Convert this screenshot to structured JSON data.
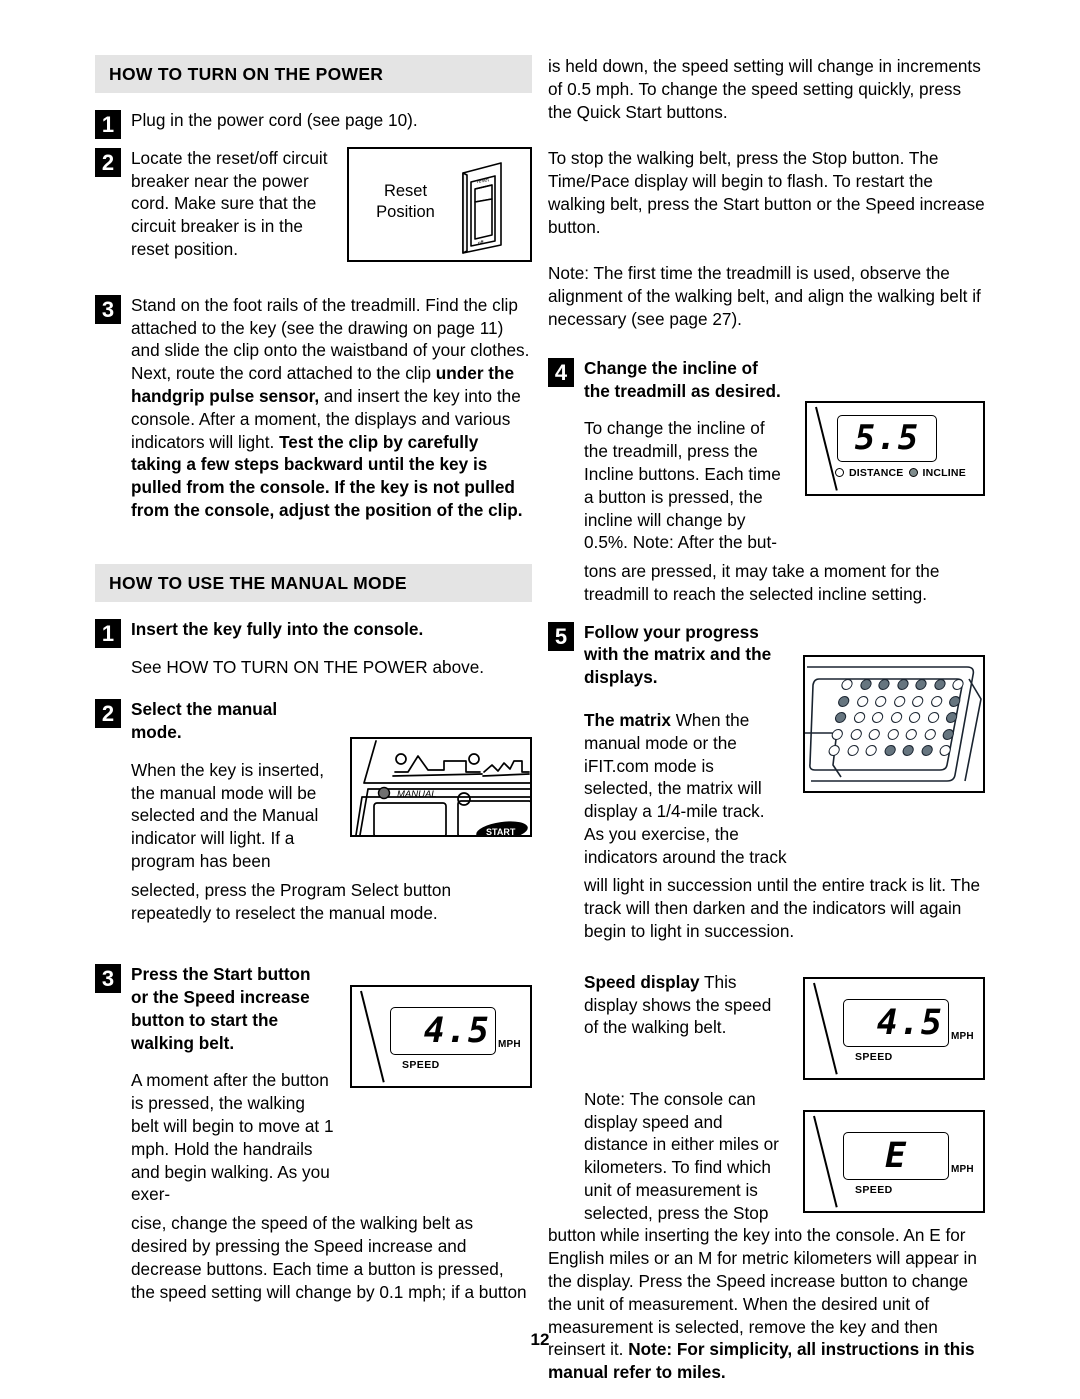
{
  "page": {
    "number": "12"
  },
  "left_column": {
    "section1": {
      "heading": "HOW TO TURN ON THE POWER",
      "steps": [
        {
          "num": "1",
          "text": "Plug in the power cord (see page 10)."
        },
        {
          "num": "2",
          "text": "Locate the reset/off circuit breaker near the power cord. Make sure that the circuit breaker is in the reset position."
        },
        {
          "num": "3",
          "text_plain_1": "Stand on the foot rails of the treadmill. Find the clip attached to the key (see the drawing on page 11) and slide the clip onto the waistband of your clothes. Next, route the cord attached to the clip ",
          "text_bold_1": "under the handgrip pulse sensor,",
          "text_plain_2": " and insert the key into the console. After a moment, the displays and various indicators will light. ",
          "text_bold_2": "Test the clip by carefully taking a few steps backward until the key is pulled from the console. If the key is not pulled from the console, adjust the position of the clip."
        }
      ],
      "figure_reset": {
        "label_line1": "Reset",
        "label_line2": "Position",
        "switch_top_text": "reset",
        "switch_bottom_text": "off"
      }
    },
    "section2": {
      "heading": "HOW TO USE THE MANUAL MODE",
      "steps": [
        {
          "num": "1",
          "title": "Insert the key fully into the console.",
          "body": "See HOW TO TURN ON THE POWER above."
        },
        {
          "num": "2",
          "title": "Select the manual mode.",
          "body_wrap": "When the key is inserted, the manual mode will be selected and the Manual indicator will light. If a program has been",
          "body_rest": "selected, press the Program Select button repeatedly to reselect the manual mode."
        },
        {
          "num": "3",
          "title": "Press the Start button or the Speed increase button to start the walking belt.",
          "body_wrap": "A moment after the button is pressed, the walking belt will begin to move at 1 mph. Hold the handrails and begin walking. As you exer-",
          "body_rest": "cise, change the speed of the walking belt as desired by pressing the Speed increase and decrease buttons. Each time a button is pressed, the speed setting will change by 0.1 mph; if a button"
        }
      ],
      "figure_console": {
        "indicator_label": "MANUAL"
      },
      "figure_speed": {
        "value": "4.5",
        "unit": "MPH",
        "caption": "SPEED"
      }
    }
  },
  "right_column": {
    "continued_paragraphs": [
      "is held down, the speed setting will change in increments of 0.5 mph. To change the speed setting quickly, press the Quick Start buttons.",
      "To stop the walking belt, press the Stop button. The Time/Pace display will begin to flash. To restart the walking belt, press the Start button or the Speed increase button.",
      "Note: The first time the treadmill is used, observe the alignment of the walking belt, and align the walking belt if necessary (see page 27)."
    ],
    "steps": [
      {
        "num": "4",
        "title": "Change the incline of the treadmill as desired.",
        "body_wrap": "To change the incline of the treadmill, press the Incline buttons. Each time a button is pressed, the incline will change by 0.5%. Note: After the but-",
        "body_rest": "tons are pressed, it may take a moment for the treadmill to reach the selected incline setting."
      },
      {
        "num": "5",
        "title": "Follow your progress with the matrix and the displays.",
        "matrix_lead_bold": "The matrix",
        "matrix_body_wrap": " When the manual mode or the iFIT.com mode is selected, the matrix will display a 1/4-mile track. As you exercise, the indicators around the track",
        "matrix_body_rest": "will light in succession until the entire track is lit. The track will then darken and the indicators will again begin to light in succession.",
        "speed_lead_bold": "Speed display",
        "speed_body": " This display shows the speed of the walking belt.",
        "note_wrap": "Note: The console can display speed and distance in either miles or kilometers. To find which unit of measurement is selected, press the Stop",
        "note_rest_1": "button while inserting the key into the console. An  E  for English miles or an  M  for metric kilometers will appear in the display. Press the Speed increase button to change the unit of measurement. When the desired unit of measurement is selected, remove the key and then reinsert it. ",
        "note_rest_bold": "Note: For simplicity, all instructions in this manual refer to miles."
      }
    ],
    "figure_incline": {
      "value": "5.5",
      "indicator_distance": "DISTANCE",
      "indicator_incline": "INCLINE"
    },
    "figure_speed": {
      "value": "4.5",
      "unit": "MPH",
      "caption": "SPEED"
    },
    "figure_units": {
      "value": "E",
      "unit": "MPH",
      "caption": "SPEED"
    }
  },
  "matrix_pattern": [
    [
      0,
      1,
      1,
      1,
      1,
      1,
      0
    ],
    [
      1,
      0,
      0,
      0,
      0,
      0,
      1
    ],
    [
      1,
      0,
      0,
      0,
      0,
      0,
      1
    ],
    [
      0,
      0,
      0,
      0,
      0,
      0,
      1
    ],
    [
      0,
      0,
      0,
      1,
      1,
      1,
      0
    ]
  ]
}
